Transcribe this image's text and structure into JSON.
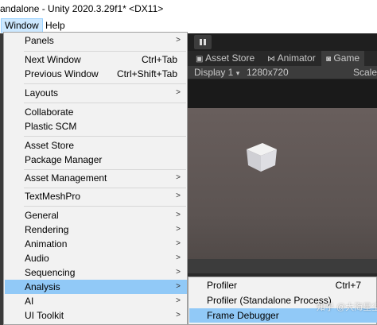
{
  "window": {
    "title": "andalone - Unity 2020.3.29f1* <DX11>"
  },
  "menubar": {
    "items": [
      {
        "label": "Window"
      },
      {
        "label": "Help"
      }
    ]
  },
  "editor": {
    "pause_icon": "pause-icon",
    "tabs": [
      {
        "label": "Asset Store",
        "icon": "store-icon"
      },
      {
        "label": "Animator",
        "icon": "animator-icon"
      },
      {
        "label": "Game",
        "icon": "game-icon"
      }
    ],
    "display": "Display 1",
    "resolution": "1280x720",
    "scale": "Scale"
  },
  "menu": {
    "items": [
      {
        "label": "Panels",
        "shortcut": "",
        "submenu": true
      },
      {
        "label": "Next Window",
        "shortcut": "Ctrl+Tab",
        "submenu": false
      },
      {
        "label": "Previous Window",
        "shortcut": "Ctrl+Shift+Tab",
        "submenu": false
      },
      {
        "label": "Layouts",
        "shortcut": "",
        "submenu": true
      },
      {
        "label": "Collaborate",
        "shortcut": "",
        "submenu": false
      },
      {
        "label": "Plastic SCM",
        "shortcut": "",
        "submenu": false
      },
      {
        "label": "Asset Store",
        "shortcut": "",
        "submenu": false
      },
      {
        "label": "Package Manager",
        "shortcut": "",
        "submenu": false
      },
      {
        "label": "Asset Management",
        "shortcut": "",
        "submenu": true
      },
      {
        "label": "TextMeshPro",
        "shortcut": "",
        "submenu": true
      },
      {
        "label": "General",
        "shortcut": "",
        "submenu": true
      },
      {
        "label": "Rendering",
        "shortcut": "",
        "submenu": true
      },
      {
        "label": "Animation",
        "shortcut": "",
        "submenu": true
      },
      {
        "label": "Audio",
        "shortcut": "",
        "submenu": true
      },
      {
        "label": "Sequencing",
        "shortcut": "",
        "submenu": true
      },
      {
        "label": "Analysis",
        "shortcut": "",
        "submenu": true,
        "highlighted": true
      },
      {
        "label": "AI",
        "shortcut": "",
        "submenu": true
      },
      {
        "label": "UI Toolkit",
        "shortcut": "",
        "submenu": true
      }
    ]
  },
  "submenu": {
    "items": [
      {
        "label": "Profiler",
        "shortcut": "Ctrl+7"
      },
      {
        "label": "Profiler (Standalone Process)",
        "shortcut": ""
      },
      {
        "label": "Frame Debugger",
        "shortcut": "",
        "highlighted": true
      }
    ]
  },
  "watermark": "知乎 @大海星尘",
  "colors": {
    "highlight": "#91c9f7",
    "menu_bg": "#f2f2f2",
    "editor_bg": "#383838"
  }
}
